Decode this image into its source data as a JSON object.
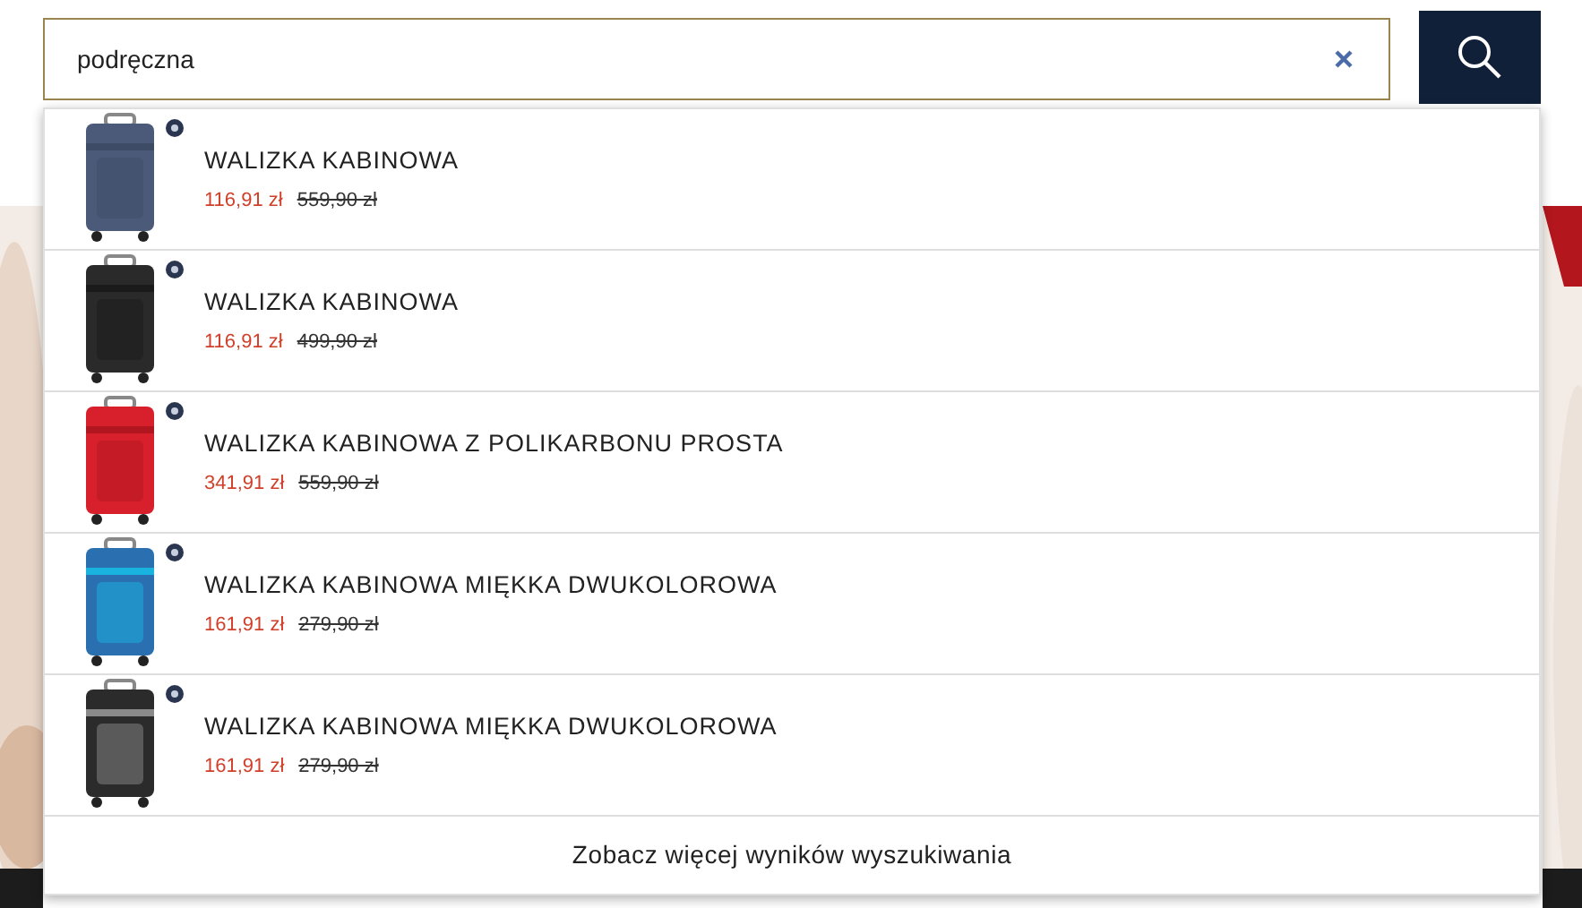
{
  "search": {
    "value": "podręczna"
  },
  "results": [
    {
      "name": "WALIZKA KABINOWA",
      "price": "116,91 zł",
      "old_price": "559,90 zł"
    },
    {
      "name": "WALIZKA KABINOWA",
      "price": "116,91 zł",
      "old_price": "499,90 zł"
    },
    {
      "name": "WALIZKA KABINOWA Z POLIKARBONU PROSTA",
      "price": "341,91 zł",
      "old_price": "559,90 zł"
    },
    {
      "name": "WALIZKA KABINOWA MIĘKKA DWUKOLOROWA",
      "price": "161,91 zł",
      "old_price": "279,90 zł"
    },
    {
      "name": "WALIZKA KABINOWA MIĘKKA DWUKOLOROWA",
      "price": "161,91 zł",
      "old_price": "279,90 zł"
    }
  ],
  "more_link": "Zobacz więcej wyników wyszukiwania"
}
